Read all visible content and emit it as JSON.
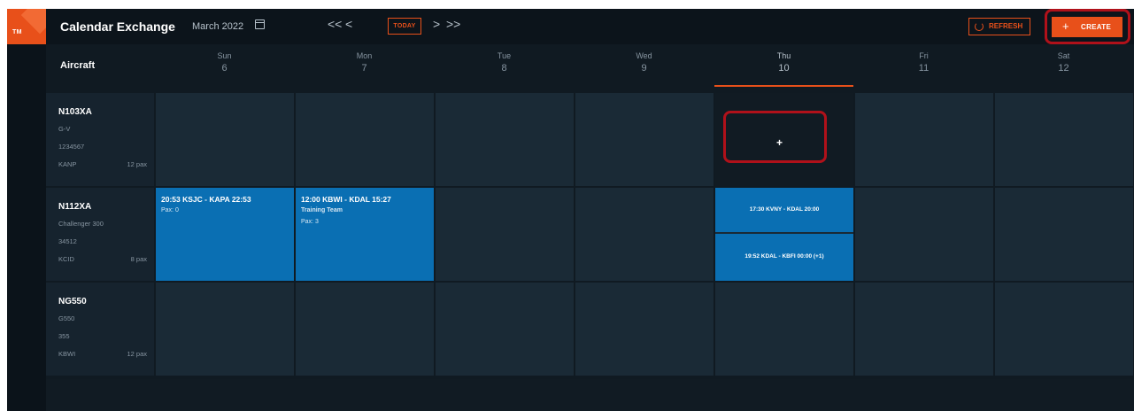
{
  "app": {
    "logo_text": "TM",
    "title": "Calendar Exchange",
    "month": "March 2022"
  },
  "nav": {
    "prev_fast": "<<",
    "prev": "<",
    "today": "TODAY",
    "next": ">",
    "next_fast": ">>"
  },
  "actions": {
    "refresh": "REFRESH",
    "create_plus": "+",
    "create": "CREATE"
  },
  "grid": {
    "header_label": "Aircraft",
    "days": [
      {
        "name": "Sun",
        "num": "6"
      },
      {
        "name": "Mon",
        "num": "7"
      },
      {
        "name": "Tue",
        "num": "8"
      },
      {
        "name": "Wed",
        "num": "9"
      },
      {
        "name": "Thu",
        "num": "10"
      },
      {
        "name": "Fri",
        "num": "11"
      },
      {
        "name": "Sat",
        "num": "12"
      }
    ],
    "add_symbol": "+",
    "aircraft": [
      {
        "reg": "N103XA",
        "type": "G-V",
        "serial": "1234567",
        "base": "KANP",
        "pax": "12 pax"
      },
      {
        "reg": "N112XA",
        "type": "Challenger 300",
        "serial": "34512",
        "base": "KCID",
        "pax": "8 pax"
      },
      {
        "reg": "NG550",
        "type": "G550",
        "serial": "355",
        "base": "KBWI",
        "pax": "12 pax"
      }
    ],
    "events": [
      {
        "title": "20:53 KSJC - KAPA 22:53",
        "line2": "Pax: 0"
      },
      {
        "title": "12:00 KBWI - KDAL 15:27",
        "line2": "Training Team",
        "line3": "Pax: 3"
      },
      {
        "title": "17:30 KVNY - KDAL 20:00"
      },
      {
        "title": "19:52 KDAL - KBFI 00:00 (+1)"
      }
    ]
  },
  "colors": {
    "accent": "#e8501a",
    "event": "#0a6fb3",
    "background": "#101a22",
    "highlight_box": "#b0111a"
  }
}
